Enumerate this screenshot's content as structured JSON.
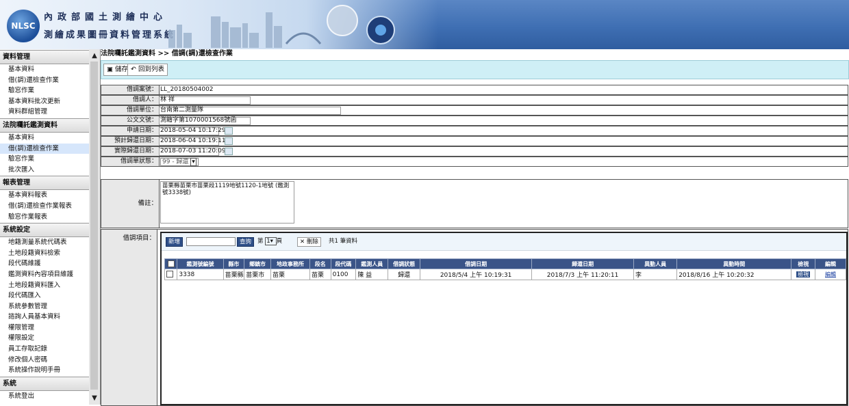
{
  "header": {
    "logo_text": "NLSC",
    "org_name": "內政部國土測繪中心",
    "system_name": "測繪成果圖冊資料管理系統"
  },
  "sidebar": {
    "sections": [
      {
        "title": "資料管理",
        "items": [
          "基本資料",
          "借(調)還檢查作業",
          "驗窓作業",
          "基本資料批次更新",
          "資料群組管理"
        ]
      },
      {
        "title": "法院囑託鑑測資料",
        "items": [
          "基本資料",
          "借(調)還檢查作業",
          "驗窓作業",
          "批次匯入"
        ],
        "active_index": 1
      },
      {
        "title": "報表管理",
        "items": [
          "基本資料報表",
          "借(調)還檢查作業報表",
          "驗窓作業報表"
        ]
      },
      {
        "title": "系統設定",
        "items": [
          "地籍測量系統代碼表",
          "土地段籍資料檢索",
          "段代碼維護",
          "鑑測資料內容項目維護",
          "土地段籍資料匯入",
          "段代碼匯入",
          "系統參數管理",
          "諮詢人員基本資料",
          "權限管理",
          "權限設定",
          "員工存取記錄",
          "修改個人密碼",
          "系統操作說明手冊"
        ]
      },
      {
        "title": "系統",
        "items": [
          "系統登出"
        ]
      }
    ]
  },
  "breadcrumb": "法院囑託鑑測資料 >> 借調(調)還檢查作業",
  "toolbar": {
    "save_label": "儲存",
    "back_label": "回到列表"
  },
  "form": {
    "case_no": {
      "label": "借調案號：",
      "value": "LL_20180504002"
    },
    "borrower": {
      "label": "借調人：",
      "value": "林 祥"
    },
    "unit": {
      "label": "借調單位：",
      "value": "台南第二測量隊"
    },
    "doc_no": {
      "label": "公文文號：",
      "value": "測籍字第1070001568號函"
    },
    "apply_date": {
      "label": "申請日期：",
      "value": "2018-05-04 10:17:29"
    },
    "expected_return": {
      "label": "預計歸還日期：",
      "value": "2018-06-04 10:19:11"
    },
    "actual_return": {
      "label": "實際歸還日期：",
      "value": "2018-07-03 11:20:09"
    },
    "status": {
      "label": "借調單狀態：",
      "value": "99 - 歸還"
    },
    "note": {
      "label": "備註：",
      "value": "苗栗縣苗栗市苗栗段1119地號1120-1地號 (鑑測號3338號)"
    }
  },
  "items": {
    "label": "借調項目：",
    "add_label": "新增",
    "search_value": "",
    "search_label": "查詢",
    "page_prefix": "第",
    "page_value": "1",
    "page_suffix": "頁",
    "delete_label": "刪除",
    "total_text": "共1 筆資料",
    "columns": [
      "鑑測號編號",
      "縣市",
      "鄉鎮市",
      "地政事務所",
      "段名",
      "段代碼",
      "鑑測人員",
      "借調狀態",
      "借調日期",
      "歸還日期",
      "異動人員",
      "異動時間",
      "檢視",
      "編輯"
    ],
    "rows": [
      {
        "id": "3338",
        "county": "苗栗縣",
        "town": "苗栗市",
        "office": "苗栗",
        "section": "苗栗",
        "code": "0100",
        "surveyor": "陳 益",
        "status": "歸還",
        "borrow_date": "2018/5/4 上午 10:19:31",
        "return_date": "2018/7/3 上午 11:20:11",
        "modifier": "李",
        "modified_time": "2018/8/16 上午 10:20:32",
        "view_label": "檢視",
        "edit_label": "編輯"
      }
    ]
  }
}
